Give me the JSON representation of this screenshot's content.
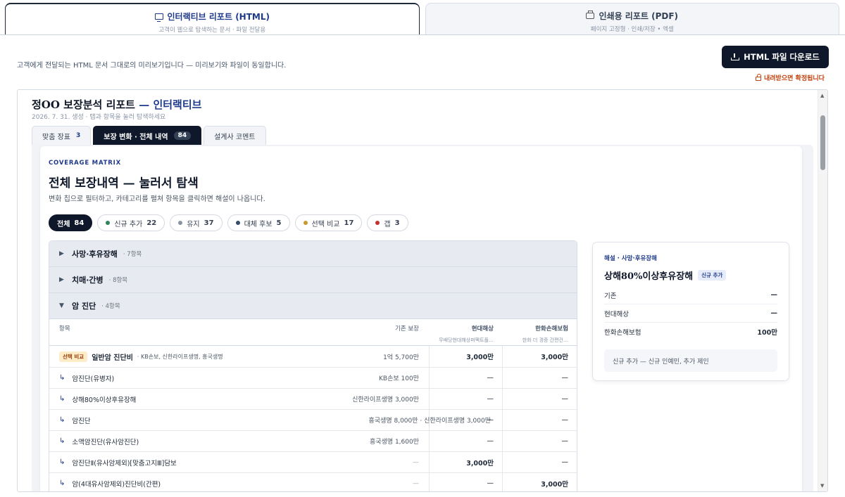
{
  "mode_tabs": [
    {
      "title": "인터랙티브 리포트 (HTML)",
      "subtitle": "고객이 웹으로 탐색하는 문서 · 파일 전달용"
    },
    {
      "title": "인쇄용 리포트 (PDF)",
      "subtitle": "페이지 고정형 · 인쇄/저장 • 엑셀"
    }
  ],
  "toolbar": {
    "description": "고객에게 전달되는 HTML 문서 그대로의 미리보기입니다 — 미리보기와 파일이 동일합니다.",
    "download_label": "HTML 파일 다운로드",
    "lock_note": "내려받으면 확정됩니다"
  },
  "report": {
    "title_main": "정OO 보장분석 리포트",
    "title_sep": " — ",
    "title_accent": "인터랙티브",
    "subtitle": "2026. 7. 31. 생성 · 탭과 항목을 눌러 탐색하세요",
    "tabs": [
      {
        "label": "맞춤 장표",
        "count": "3"
      },
      {
        "label": "보장 변화 · 전체 내역",
        "count": "84"
      },
      {
        "label": "설계사 코멘트",
        "count": ""
      }
    ]
  },
  "matrix_section": {
    "eyebrow": "COVERAGE MATRIX",
    "title": "전체 보장내역 — 눌러서 탐색",
    "subtitle": "변화 칩으로 필터하고, 카테고리를 펼쳐 항목을 클릭하면 해설이 나옵니다.",
    "chips": [
      {
        "label": "전체",
        "count": "84",
        "color": ""
      },
      {
        "label": "신규 추가",
        "count": "22",
        "color": "#2f855a"
      },
      {
        "label": "유지",
        "count": "37",
        "color": "#8a94a6"
      },
      {
        "label": "대체 후보",
        "count": "5",
        "color": "#334e68"
      },
      {
        "label": "선택 비교",
        "count": "17",
        "color": "#c99a2e"
      },
      {
        "label": "갭",
        "count": "3",
        "color": "#c53030"
      }
    ],
    "categories": [
      {
        "arrow": "▶",
        "name": "사망·후유장해",
        "count": "· 7항목"
      },
      {
        "arrow": "▶",
        "name": "치매·간병",
        "count": "· 8항목"
      },
      {
        "arrow": "▼",
        "name": "암 진단",
        "count": "· 4항목"
      }
    ],
    "columns": {
      "item": "항목",
      "base": "기존 보장",
      "c1": "현대해상",
      "c1_sub": "무배당현대해상퍼펙트플…",
      "c2": "한화손해보험",
      "c2_sub": "한화 더 경증 간편건…"
    },
    "first_row": {
      "tag": "선택 비교",
      "name": "일반암 진단비",
      "insurers": "· KB손보, 신한라이프생명, 흥국생명",
      "base": "1억 5,700만",
      "v1": "3,000만",
      "v2": "3,000만"
    },
    "rows": [
      {
        "name": "암진단(유병자)",
        "base": "KB손보 100만",
        "v1": "—",
        "v2": "—"
      },
      {
        "name": "상해80%이상후유장해",
        "base": "신한라이프생명 3,000만",
        "v1": "—",
        "v2": "—"
      },
      {
        "name": "암진단",
        "base": "흥국생명 8,000만 · 신한라이프생명 3,000만",
        "v1": "—",
        "v2": "—"
      },
      {
        "name": "소액암진단(유사암진단)",
        "base": "흥국생명 1,600만",
        "v1": "—",
        "v2": "—"
      },
      {
        "name": "암진단Ⅱ(유사암제외)[맞춤고지Ⅲ]담보",
        "base": "—",
        "v1": "3,000만",
        "v2": "—"
      },
      {
        "name": "암(4대유사암제외)진단비(간편)",
        "base": "—",
        "v1": "—",
        "v2": "3,000만"
      }
    ]
  },
  "side_panel": {
    "caption": "해설 · 사망·후유장해",
    "item_name": "상해80%이상후유장해",
    "badge": "신규 추가",
    "rows": [
      {
        "label": "기존",
        "value": "—"
      },
      {
        "label": "현대해상",
        "value": "—"
      },
      {
        "label": "한화손해보험",
        "value": "100만"
      }
    ],
    "note": "신규 추가 — 신규 인예민, 추가 제인"
  },
  "scrollbar": {
    "up": "▲",
    "down": "▼"
  }
}
